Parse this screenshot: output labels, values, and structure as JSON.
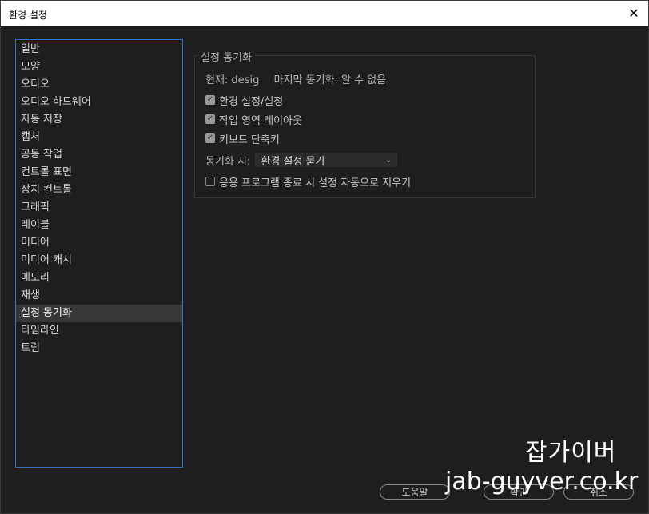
{
  "window": {
    "title": "환경 설정",
    "close_glyph": "✕"
  },
  "sidebar": {
    "items": [
      {
        "label": "일반"
      },
      {
        "label": "모양"
      },
      {
        "label": "오디오"
      },
      {
        "label": "오디오 하드웨어"
      },
      {
        "label": "자동 저장"
      },
      {
        "label": "캡처"
      },
      {
        "label": "공동 작업"
      },
      {
        "label": "컨트롤 표면"
      },
      {
        "label": "장치 컨트롤"
      },
      {
        "label": "그래픽"
      },
      {
        "label": "레이블"
      },
      {
        "label": "미디어"
      },
      {
        "label": "미디어 캐시"
      },
      {
        "label": "메모리"
      },
      {
        "label": "재생"
      },
      {
        "label": "설정 동기화"
      },
      {
        "label": "타임라인"
      },
      {
        "label": "트림"
      }
    ],
    "selected_label": "설정 동기화"
  },
  "sync_panel": {
    "group_title": "설정 동기화",
    "current_label": "현재: desig",
    "last_sync_label": "마지막 동기화: 알 수 없음",
    "checkboxes": [
      {
        "label": "환경 설정/설정",
        "checked": true
      },
      {
        "label": "작업 영역 레이아웃",
        "checked": true
      },
      {
        "label": "키보드 단축키",
        "checked": true
      }
    ],
    "sync_when_label": "동기화 시:",
    "sync_when_value": "환경 설정 묻기",
    "auto_clear": {
      "label": "응용 프로그램 종료 시 설정 자동으로 지우기",
      "checked": false
    }
  },
  "buttons": {
    "help": "도움말",
    "ok": "확인",
    "cancel": "취소"
  },
  "watermark": {
    "line1": "잡가이버",
    "line2": "jab-guyver.co.kr"
  },
  "colors": {
    "selection_border": "#2d73c9",
    "background": "#1e1e1e"
  }
}
